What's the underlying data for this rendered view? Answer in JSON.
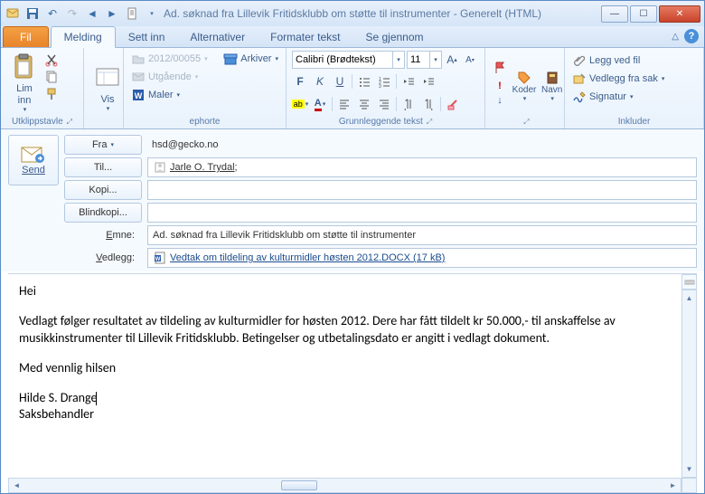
{
  "title": "Ad. søknad fra Lillevik Fritidsklubb om støtte til instrumenter - Generelt (HTML)",
  "tabs": {
    "file": "Fil",
    "message": "Melding",
    "insert": "Sett inn",
    "options": "Alternativer",
    "format": "Formater tekst",
    "review": "Se gjennom"
  },
  "ribbon": {
    "clipboard": {
      "paste": "Lim\ninn",
      "label": "Utklippstavle"
    },
    "show": {
      "show": "Vis",
      "label": ""
    },
    "ephorte": {
      "caseno": "2012/00055",
      "outgoing": "Utgående",
      "templates": "Maler",
      "archive": "Arkiver",
      "label": "ephorte"
    },
    "font": {
      "name": "Calibri (Brødtekst)",
      "size": "11",
      "label": "Grunnleggende tekst"
    },
    "tags": {
      "codes": "Koder",
      "names": "Navn",
      "label": ""
    },
    "include": {
      "attach_file": "Legg ved fil",
      "attach_case": "Vedlegg fra sak",
      "signature": "Signatur",
      "label": "Inkluder"
    }
  },
  "header": {
    "send": "Send",
    "from_btn": "Fra",
    "from_val": "hsd@gecko.no",
    "to_btn": "Til...",
    "to_val": "Jarle O. Trydal",
    "cc_btn": "Kopi...",
    "bcc_btn": "Blindkopi...",
    "subject_lbl": "Emne:",
    "subject_val": "Ad. søknad fra Lillevik Fritidsklubb om støtte til instrumenter",
    "attach_lbl": "Vedlegg:",
    "attach_val": "Vedtak om tildeling av kulturmidler høsten 2012.DOCX (17 kB)"
  },
  "body": {
    "p1": "Hei",
    "p2": "Vedlagt følger resultatet av tildeling av kulturmidler for høsten 2012. Dere har fått tildelt kr 50.000,- til anskaffelse av musikkinstrumenter til Lillevik Fritidsklubb. Betingelser og utbetalingsdato er angitt i vedlagt dokument.",
    "p3": "Med vennlig hilsen",
    "p4": "Hilde S. Drange",
    "p5": "Saksbehandler"
  }
}
